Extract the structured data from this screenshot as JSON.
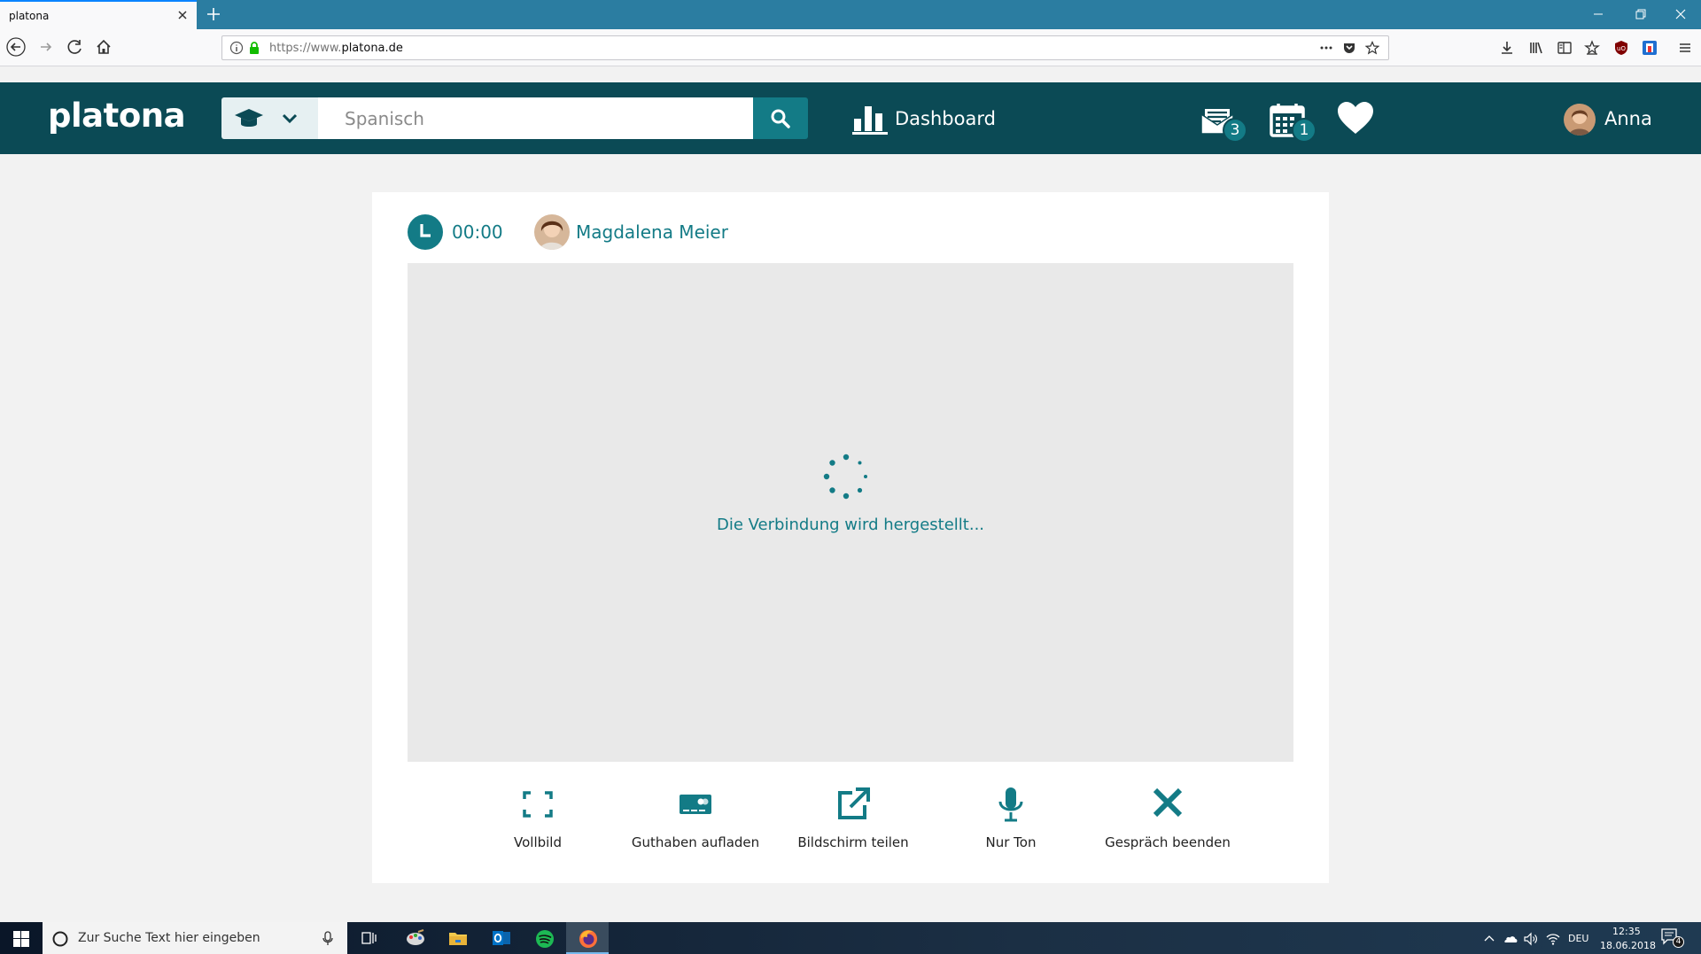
{
  "browser": {
    "tab_title": "platona",
    "url_prefix": "https://www.",
    "url_domain": "platona.de"
  },
  "header": {
    "logo": "platona",
    "search_placeholder": "Spanisch",
    "dashboard_label": "Dashboard",
    "messages_badge": "3",
    "calendar_badge": "1",
    "user_name": "Anna"
  },
  "call": {
    "timer": "00:00",
    "partner_name": "Magdalena Meier",
    "status_text": "Die Verbindung wird hergestellt...",
    "controls": {
      "fullscreen": "Vollbild",
      "topup": "Guthaben aufladen",
      "share_screen": "Bildschirm teilen",
      "audio_only": "Nur Ton",
      "end_call": "Gespräch beenden"
    }
  },
  "taskbar": {
    "search_placeholder": "Zur Suche Text hier eingeben",
    "language": "DEU",
    "time": "12:35",
    "date": "18.06.2018",
    "notification_count": "4"
  },
  "colors": {
    "brand_dark": "#0b4a55",
    "accent": "#137b86",
    "video_bg": "#e9e9e9"
  }
}
